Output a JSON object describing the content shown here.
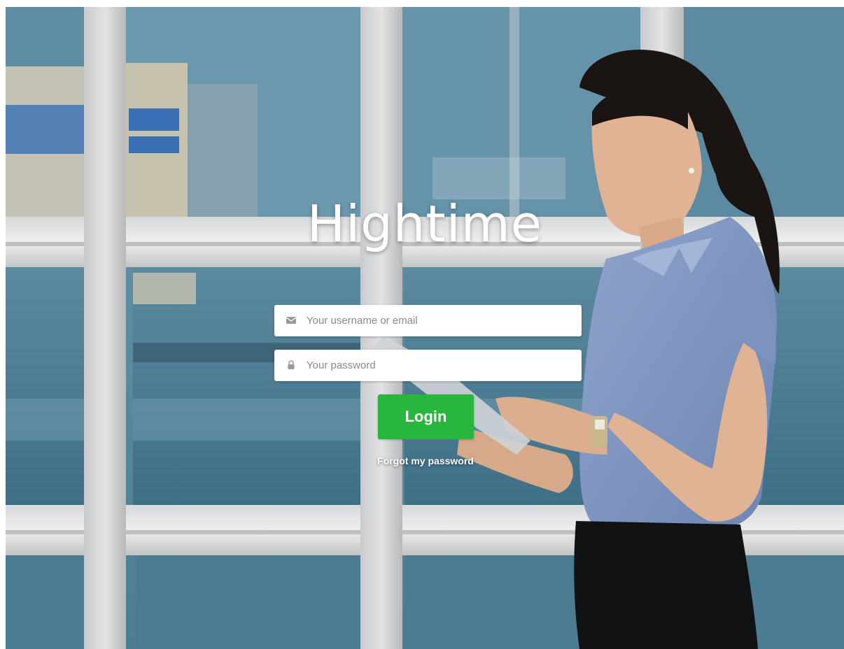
{
  "app": {
    "title": "Hightime"
  },
  "login_form": {
    "username": {
      "placeholder": "Your username or email",
      "value": "",
      "icon": "envelope-icon"
    },
    "password": {
      "placeholder": "Your password",
      "value": "",
      "icon": "lock-icon"
    },
    "login_label": "Login",
    "forgot_label": "Forgot my password"
  },
  "colors": {
    "accent_green": "#28b63e",
    "field_background": "#ffffff",
    "title_color": "#ffffff",
    "backdrop_blue": "#4f7f96"
  }
}
